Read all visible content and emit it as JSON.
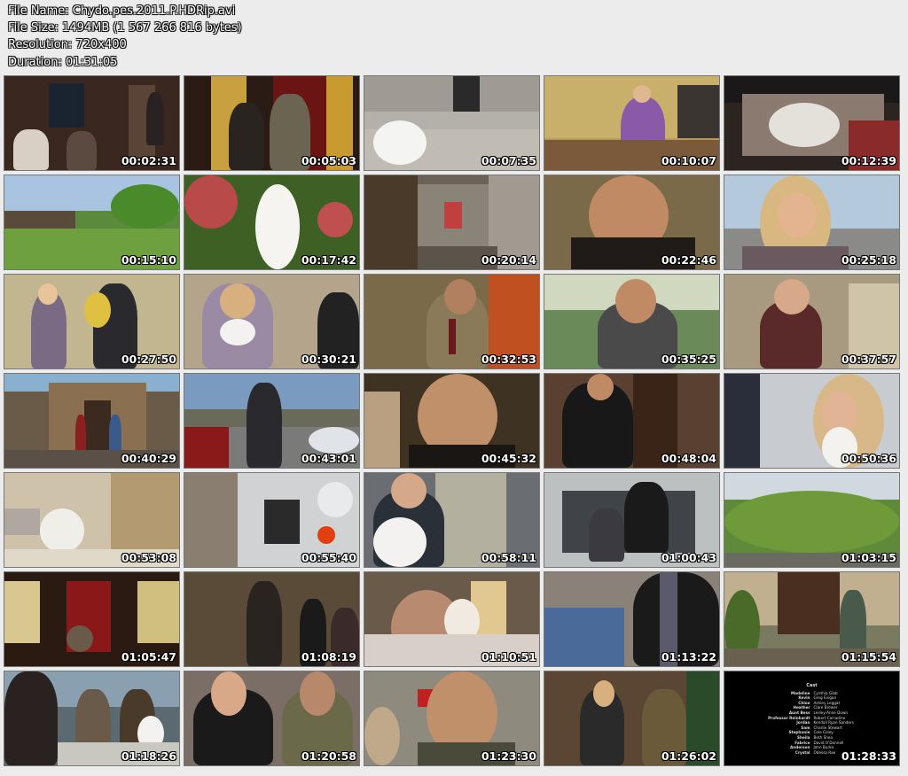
{
  "info": {
    "file_name": "File Name: Chydo.pes.2011.P.HDRip.avi",
    "file_size": "File Size: 1494MB (1 567 266 816 bytes)",
    "resolution": "Resolution: 720x400",
    "duration": "Duration: 01:31:05"
  },
  "thumbnails": [
    {
      "time": "00:02:31",
      "bg": "#3a2820",
      "scene": "living-room"
    },
    {
      "time": "00:05:03",
      "bg": "#2a1c14",
      "scene": "doorway"
    },
    {
      "time": "00:07:35",
      "bg": "#8a8a86",
      "scene": "dog-steps"
    },
    {
      "time": "00:10:07",
      "bg": "#b59a5a",
      "scene": "office-woman"
    },
    {
      "time": "00:12:39",
      "bg": "#2c2420",
      "scene": "dog-sofa"
    },
    {
      "time": "00:15:10",
      "bg": "#5c8a3c",
      "scene": "backyard"
    },
    {
      "time": "00:17:42",
      "bg": "#4e6a2a",
      "scene": "dog-bushes"
    },
    {
      "time": "00:20:14",
      "bg": "#6a6256",
      "scene": "hallway"
    },
    {
      "time": "00:22:46",
      "bg": "#6a5a3c",
      "scene": "man-closeup"
    },
    {
      "time": "00:25:18",
      "bg": "#9ab0c4",
      "scene": "woman-street"
    },
    {
      "time": "00:27:50",
      "bg": "#c2b690",
      "scene": "couple-flowers"
    },
    {
      "time": "00:30:21",
      "bg": "#b4a48c",
      "scene": "woman-dog"
    },
    {
      "time": "00:32:53",
      "bg": "#7a6a4a",
      "scene": "man-phone"
    },
    {
      "time": "00:35:25",
      "bg": "#6a8a5a",
      "scene": "man-palm"
    },
    {
      "time": "00:37:57",
      "bg": "#a89a80",
      "scene": "woman-room"
    },
    {
      "time": "00:40:29",
      "bg": "#6a5a48",
      "scene": "house-front"
    },
    {
      "time": "00:43:01",
      "bg": "#6e8aa8",
      "scene": "man-cars"
    },
    {
      "time": "00:45:32",
      "bg": "#3e3222",
      "scene": "man-smile"
    },
    {
      "time": "00:48:04",
      "bg": "#5a4030",
      "scene": "man-door"
    },
    {
      "time": "00:50:36",
      "bg": "#c8ccd0",
      "scene": "woman-office-dog"
    },
    {
      "time": "00:53:08",
      "bg": "#cfc2aa",
      "scene": "dog-hall"
    },
    {
      "time": "00:55:40",
      "bg": "#8a7e70",
      "scene": "jeep"
    },
    {
      "time": "00:58:11",
      "bg": "#6a6e72",
      "scene": "boy-dog"
    },
    {
      "time": "01:00:43",
      "bg": "#bcc0c0",
      "scene": "car-interior"
    },
    {
      "time": "01:03:15",
      "bg": "#5e8a3a",
      "scene": "hillside"
    },
    {
      "time": "01:05:47",
      "bg": "#2a1a12",
      "scene": "red-door"
    },
    {
      "time": "01:08:19",
      "bg": "#5a4a38",
      "scene": "group-hall"
    },
    {
      "time": "01:10:51",
      "bg": "#6a5a4a",
      "scene": "woman-bed-dog"
    },
    {
      "time": "01:13:22",
      "bg": "#8a8278",
      "scene": "man-solar"
    },
    {
      "time": "01:15:54",
      "bg": "#7a7a60",
      "scene": "porch"
    },
    {
      "time": "01:18:26",
      "bg": "#5a6a70",
      "scene": "group-counter"
    },
    {
      "time": "01:20:58",
      "bg": "#7a6e66",
      "scene": "couple-walk"
    },
    {
      "time": "01:23:30",
      "bg": "#8e8a7e",
      "scene": "man-exit"
    },
    {
      "time": "01:26:02",
      "bg": "#5a4632",
      "scene": "party"
    },
    {
      "time": "01:28:33",
      "bg": "#000000",
      "scene": "credits"
    }
  ],
  "credits": {
    "title": "Cast",
    "rows": [
      [
        "Madeline",
        "Cynthia Gibb"
      ],
      [
        "Kevin",
        "Greg Evigan"
      ],
      [
        "Chloe",
        "Ashley Leggat"
      ],
      [
        "Heather",
        "Clare Brewer"
      ],
      [
        "Aunt Bess",
        "Lesley-Anne Down"
      ],
      [
        "Professor Reinhardt",
        "Robert Carradine"
      ],
      [
        "Jordan",
        "Kendall Ryan Sanders"
      ],
      [
        "Sam",
        "Charlie Stewart"
      ],
      [
        "Stephanie",
        "Cole Coley"
      ],
      [
        "Sheila",
        "Beth Shea"
      ],
      [
        "Fabrice",
        "David O'Donnell"
      ],
      [
        "Anderson",
        "John Burke"
      ],
      [
        "Crystal",
        "Odessa Rae"
      ]
    ]
  }
}
